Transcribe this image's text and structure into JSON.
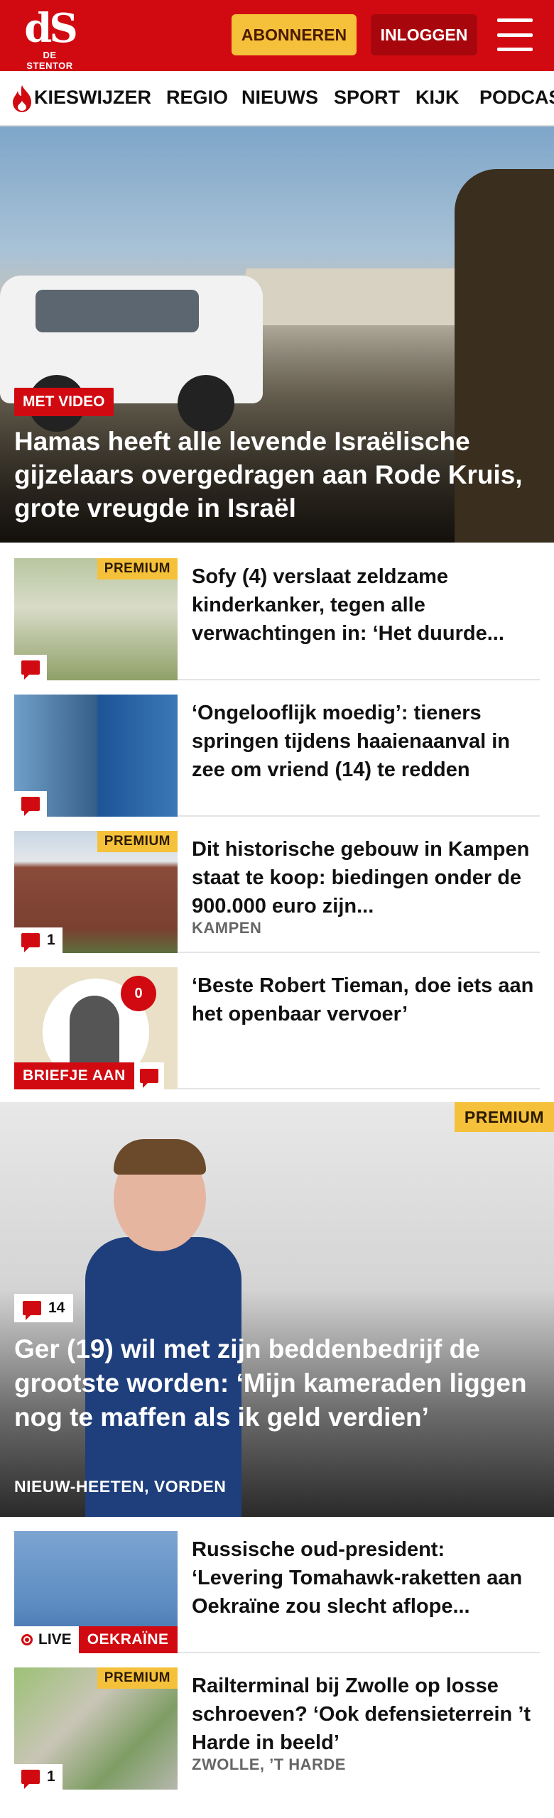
{
  "header": {
    "logo_mark": "dS",
    "logo_sub": "DE STENTOR",
    "subscribe_label": "ABONNEREN",
    "login_label": "INLOGGEN"
  },
  "nav": {
    "items": [
      "KIESWIJZER",
      "REGIO",
      "NIEUWS",
      "SPORT",
      "KIJK",
      "PODCASTS"
    ]
  },
  "hero": {
    "badge": "MET VIDEO",
    "title": "Hamas heeft alle levende Israëlische gijzelaars overgedragen aan Rode Kruis, grote vreugde in Israël"
  },
  "articles": [
    {
      "title": "Sofy (4) verslaat zeldzame kinderkanker, tegen alle verwachtingen in: ‘Het duurde...",
      "premium": "PREMIUM",
      "comments": ""
    },
    {
      "title": "‘Ongelooflijk moedig’: tieners springen tijdens haaienaanval in zee om vriend (14) te redden",
      "comments": ""
    },
    {
      "title": "Dit historische gebouw in Kampen staat te koop: biedingen onder de 900.000 euro zijn...",
      "premium": "PREMIUM",
      "location": "KAMPEN",
      "comments": "1"
    },
    {
      "title": "‘Beste Robert Tieman, doe iets aan het openbaar vervoer’",
      "tag": "BRIEFJE AAN",
      "badge_count": "0"
    }
  ],
  "feature": {
    "premium": "PREMIUM",
    "comments": "14",
    "title": "Ger (19) wil met zijn beddenbedrijf de grootste worden: ‘Mijn kameraden liggen nog te maffen als ik geld verdien’",
    "location": "NIEUW-HEETEN, VORDEN"
  },
  "articles2": [
    {
      "title": "Russische oud-president: ‘Levering Tomahawk-raketten aan Oekraïne zou slecht aflope...",
      "live": "LIVE",
      "category": "OEKRAÏNE"
    },
    {
      "title": "Railterminal bij Zwolle op losse schroeven? ‘Ook defensieterrein ’t Harde in beeld’",
      "premium": "PREMIUM",
      "location": "ZWOLLE, ’T HARDE",
      "comments": "1"
    }
  ],
  "colors": {
    "brand_red": "#d10a11",
    "premium_yellow": "#f5c13a",
    "login_dark_red": "#a8060d"
  },
  "icons": [
    "hamburger-menu-icon",
    "flame-icon",
    "comment-icon",
    "live-dot-icon"
  ]
}
